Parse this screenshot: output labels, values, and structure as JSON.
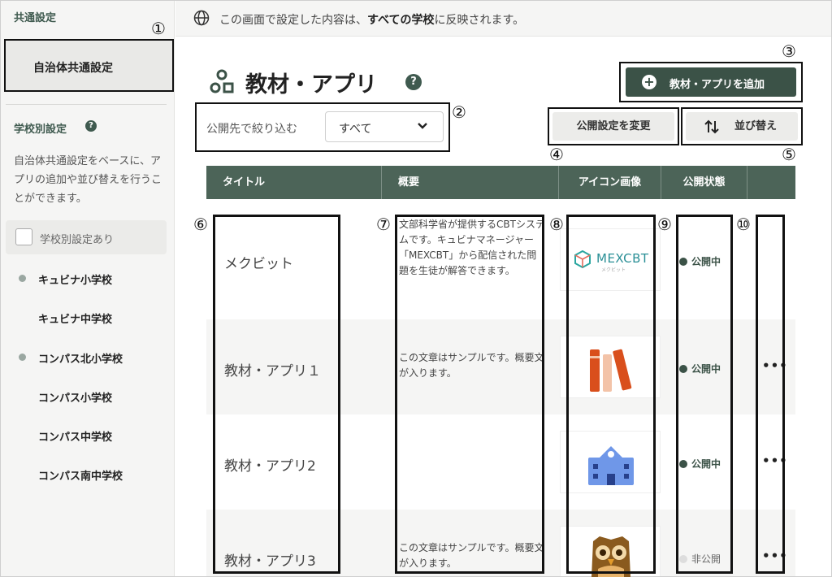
{
  "sidebar": {
    "common_heading": "共通設定",
    "common_item": "自治体共通設定",
    "school_heading": "学校別設定",
    "description": "自治体共通設定をベースに、アプリの追加や並び替えを行うことができます。",
    "checkbox_label": "学校別設定あり",
    "schools": [
      {
        "name": "キュビナ小学校",
        "marked": true
      },
      {
        "name": "キュビナ中学校",
        "marked": false
      },
      {
        "name": "コンパス北小学校",
        "marked": true
      },
      {
        "name": "コンパス小学校",
        "marked": false
      },
      {
        "name": "コンパス中学校",
        "marked": false
      },
      {
        "name": "コンパス南中学校",
        "marked": false
      }
    ]
  },
  "topbar": {
    "message_prefix": "この画面で設定した内容は、",
    "message_bold": "すべての学校",
    "message_suffix": "に反映されます。"
  },
  "page": {
    "title": "教材・アプリ",
    "help": "?",
    "add_button": "教材・アプリを追加",
    "filter_label": "公開先で絞り込む",
    "filter_value": "すべて",
    "visibility_button": "公開設定を変更",
    "sort_button": "並び替え"
  },
  "table": {
    "headers": [
      "タイトル",
      "概要",
      "アイコン画像",
      "公開状態",
      ""
    ],
    "rows": [
      {
        "title": "メクビット",
        "desc": "文部科学省が提供するCBTシステムです。キュビナマネージャー「MEXCBT」から配信された問題を生徒が解答できます。",
        "icon": "mexcbt-logo",
        "logo_text": "MEXCBT",
        "logo_sub": "メクビット",
        "status": "公開中",
        "published": true,
        "menu": ""
      },
      {
        "title": "教材・アプリ１",
        "desc": "この文章はサンプルです。概要文が入ります。",
        "icon": "books-icon",
        "status": "公開中",
        "published": true,
        "menu": "•••"
      },
      {
        "title": "教材・アプリ2",
        "desc": "",
        "icon": "school-building-icon",
        "status": "公開中",
        "published": true,
        "menu": "•••"
      },
      {
        "title": "教材・アプリ3",
        "desc": "この文章はサンプルです。概要文が入ります。",
        "icon": "owl-icon",
        "status": "非公開",
        "published": false,
        "menu": "•••"
      }
    ]
  },
  "annotations": [
    "①",
    "②",
    "③",
    "④",
    "⑤",
    "⑥",
    "⑦",
    "⑧",
    "⑨",
    "⑩"
  ]
}
